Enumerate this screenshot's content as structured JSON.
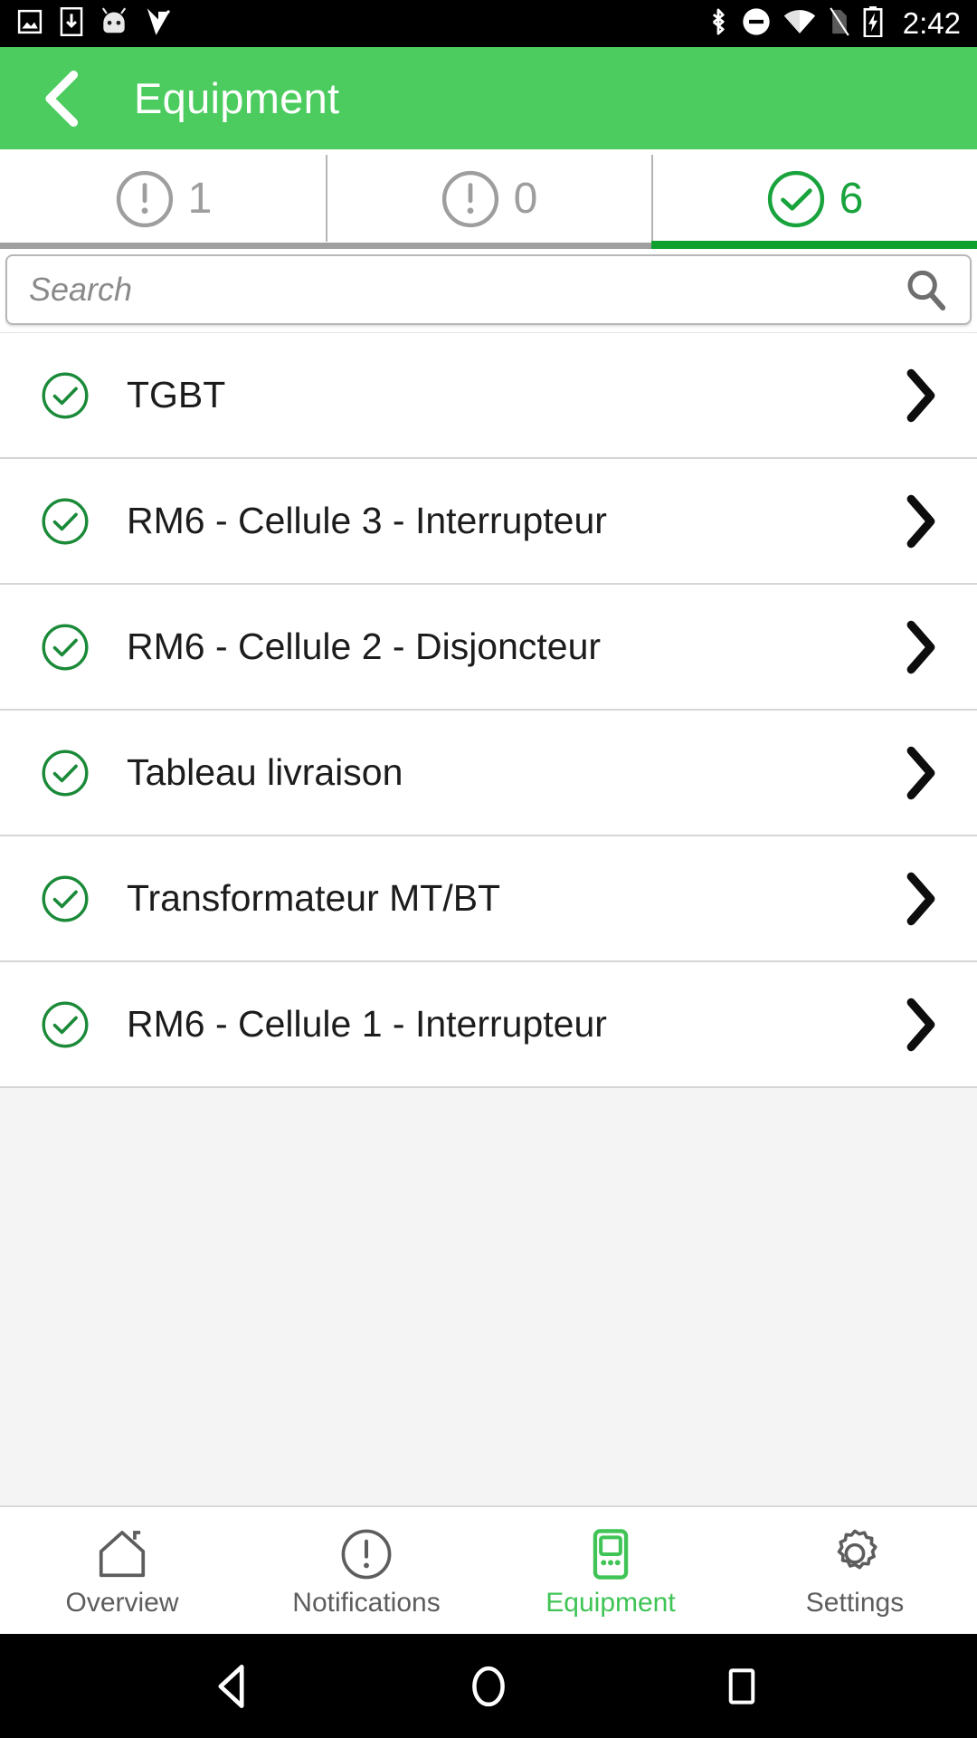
{
  "statusbar": {
    "time": "2:42",
    "left_icons": [
      "image-icon",
      "download-icon",
      "android-head-icon",
      "play-check-icon"
    ],
    "right_icons": [
      "bluetooth-icon",
      "do-not-disturb-icon",
      "wifi-icon",
      "no-sim-icon",
      "battery-charging-icon"
    ]
  },
  "appbar": {
    "title": "Equipment",
    "back_icon": "chevron-left-icon",
    "background_color": "#4ccc5f"
  },
  "tabs": [
    {
      "icon": "alert-circle-icon",
      "count": "1",
      "active": false
    },
    {
      "icon": "alert-circle-icon",
      "count": "0",
      "active": false
    },
    {
      "icon": "check-circle-icon",
      "count": "6",
      "active": true
    }
  ],
  "search": {
    "placeholder": "Search",
    "value": "",
    "icon": "search-icon"
  },
  "list": {
    "items": [
      {
        "label": "TGBT",
        "status_icon": "check-circle-icon",
        "chevron": "chevron-right-icon"
      },
      {
        "label": "RM6 - Cellule 3 - Interrupteur",
        "status_icon": "check-circle-icon",
        "chevron": "chevron-right-icon"
      },
      {
        "label": "RM6 - Cellule 2 - Disjoncteur",
        "status_icon": "check-circle-icon",
        "chevron": "chevron-right-icon"
      },
      {
        "label": "Tableau livraison",
        "status_icon": "check-circle-icon",
        "chevron": "chevron-right-icon"
      },
      {
        "label": "Transformateur MT/BT",
        "status_icon": "check-circle-icon",
        "chevron": "chevron-right-icon"
      },
      {
        "label": "RM6 - Cellule 1 - Interrupteur",
        "status_icon": "check-circle-icon",
        "chevron": "chevron-right-icon"
      }
    ]
  },
  "bottomnav": {
    "items": [
      {
        "label": "Overview",
        "icon": "home-icon",
        "active": false
      },
      {
        "label": "Notifications",
        "icon": "alert-circle-icon",
        "active": false
      },
      {
        "label": "Equipment",
        "icon": "device-icon",
        "active": true
      },
      {
        "label": "Settings",
        "icon": "gear-icon",
        "active": false
      }
    ]
  },
  "androidnav": {
    "buttons": [
      "back-triangle-icon",
      "home-circle-icon",
      "recents-square-icon"
    ]
  },
  "colors": {
    "accent_green": "#4ccc5f",
    "status_green": "#19a33c",
    "inactive_gray": "#9e9e9e"
  }
}
